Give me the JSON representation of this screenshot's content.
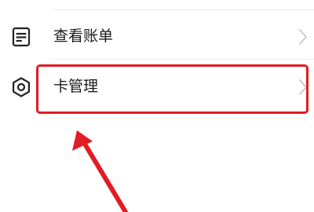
{
  "menu": {
    "items": [
      {
        "label": "查看账单",
        "icon": "bill-list-icon"
      },
      {
        "label": "卡管理",
        "icon": "gear-icon"
      }
    ]
  },
  "annotation": {
    "highlight_color": "#e31b23",
    "arrow_color": "#e31b23"
  },
  "colors": {
    "text": "#1a1a1a",
    "icon": "#222222",
    "chevron": "#c8c8c8",
    "divider": "#ececec"
  }
}
